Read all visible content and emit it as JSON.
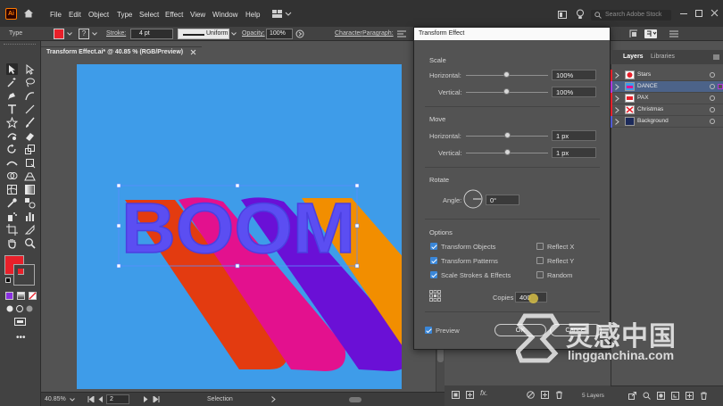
{
  "app": {
    "logo": "Ai",
    "menus": [
      "File",
      "Edit",
      "Object",
      "Type",
      "Select",
      "Effect",
      "View",
      "Window",
      "Help"
    ],
    "search_placeholder": "Search Adobe Stock"
  },
  "control_bar": {
    "selection_type": "Type",
    "stroke_label": "Stroke:",
    "stroke_value": "4 pt",
    "stroke_profile": "Uniform",
    "opacity_label": "Opacity:",
    "opacity_value": "100%",
    "character_label": "Character",
    "paragraph_label": "Paragraph:",
    "fill_color": "#e8202a"
  },
  "document": {
    "tab_title": "Transform Effect.ai* @ 40.85 % (RGB/Preview)",
    "artboard_color": "#3e9ce9",
    "headline": "BOOM",
    "headline_color": "#5b4ef2",
    "shadow_colors": [
      "#e33b10",
      "#e3118e",
      "#6a10d6",
      "#f28e00"
    ]
  },
  "status_bar": {
    "zoom": "40.85%",
    "artboard_number": "2",
    "tool_name": "Selection"
  },
  "dialog": {
    "title": "Transform Effect",
    "scale": {
      "heading": "Scale",
      "horizontal_label": "Horizontal:",
      "horizontal_value": "100%",
      "vertical_label": "Vertical:",
      "vertical_value": "100%"
    },
    "move": {
      "heading": "Move",
      "horizontal_label": "Horizontal:",
      "horizontal_value": "1 px",
      "vertical_label": "Vertical:",
      "vertical_value": "1 px"
    },
    "rotate": {
      "heading": "Rotate",
      "angle_label": "Angle:",
      "angle_value": "0°"
    },
    "options": {
      "heading": "Options",
      "transform_objects": "Transform Objects",
      "transform_patterns": "Transform Patterns",
      "scale_strokes": "Scale Strokes & Effects",
      "reflect_x": "Reflect X",
      "reflect_y": "Reflect Y",
      "random": "Random",
      "copies_label": "Copies",
      "copies_value": "400"
    },
    "preview_label": "Preview",
    "ok_label": "OK",
    "cancel_label": "Cancel"
  },
  "layers_panel": {
    "tabs": [
      "Layers",
      "Libraries"
    ],
    "layers": [
      {
        "name": "Stars",
        "color": "#e8202a"
      },
      {
        "name": "DANCE",
        "color": "#b03ad8"
      },
      {
        "name": "PAX",
        "color": "#e8202a"
      },
      {
        "name": "Christmas",
        "color": "#e8202a"
      },
      {
        "name": "Background",
        "color": "#4f5bd5"
      }
    ],
    "footer_count": "5 Layers"
  },
  "watermark": {
    "chinese_text": "灵感中国",
    "url_text": "lingganchina.com"
  }
}
